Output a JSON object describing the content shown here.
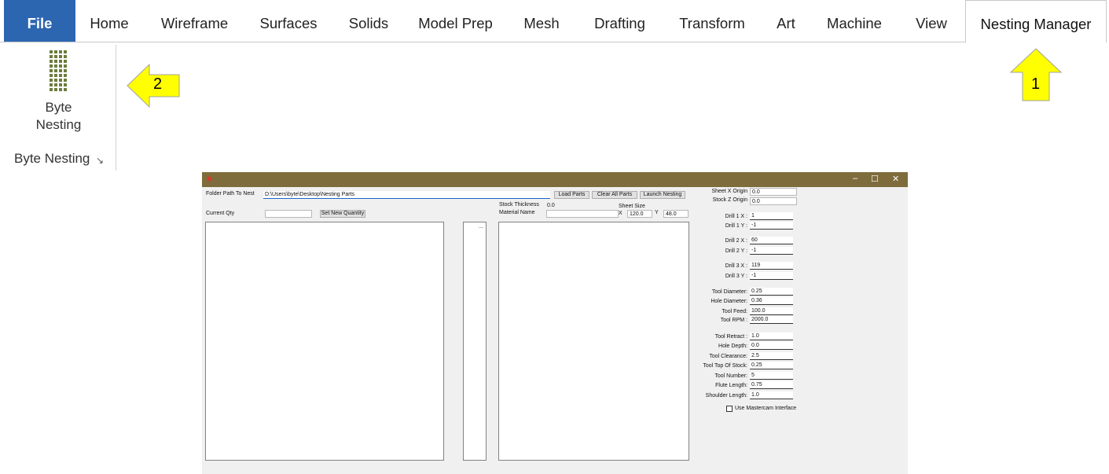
{
  "ribbon": {
    "tabs": [
      "File",
      "Home",
      "Wireframe",
      "Surfaces",
      "Solids",
      "Model Prep",
      "Mesh",
      "Drafting",
      "Transform",
      "Art",
      "Machine",
      "View",
      "Nesting Manager"
    ],
    "active_tab": "Nesting Manager",
    "file_color": "#2c66b1",
    "button": {
      "line1": "Byte",
      "line2": "Nesting",
      "icon": "grid-dots-icon"
    },
    "group_label": "Byte Nesting",
    "callouts": [
      "1",
      "2"
    ],
    "callout_color": "#ffff00"
  },
  "app": {
    "titlebar_color": "#7e6c3c",
    "controls": [
      "–",
      "☐",
      "✕"
    ],
    "folder_label": "Folder Path To Nest",
    "folder_value": "D:\\Users\\byte\\Desktop\\Nesting Parts",
    "load_parts": "Load Parts",
    "clear_all": "Clear All Parts",
    "launch": "Launch Nesting",
    "current_qty_label": "Current Qty",
    "current_qty_value": "",
    "set_qty": "Set New Quantity",
    "stock_thickness_label": "Stock Thickness",
    "stock_thickness_value": "0.0",
    "material_name_label": "Material Name",
    "material_name_value": "",
    "sheet_size_label": "Sheet Size",
    "sheet_x_label": "X",
    "sheet_x_value": "120.0",
    "sheet_y_label": "Y",
    "sheet_y_value": "48.0",
    "ellipsis": "...",
    "settings": [
      {
        "label": "Sheet X Origin",
        "value": "0.0"
      },
      {
        "label": "Stock Z Origin",
        "value": "0.0"
      },
      {
        "label": "Drill 1 X :",
        "value": "1"
      },
      {
        "label": "Drill 1 Y :",
        "value": "-1"
      },
      {
        "label": "Drill 2 X :",
        "value": "60"
      },
      {
        "label": "Drill 2 Y :",
        "value": "-1"
      },
      {
        "label": "Drill 3 X :",
        "value": "119"
      },
      {
        "label": "Drill 3 Y :",
        "value": "-1"
      },
      {
        "label": "Tool Diameter:",
        "value": "0.25"
      },
      {
        "label": "Hole Diameter:",
        "value": "0.36"
      },
      {
        "label": "Tool Feed:",
        "value": "100.0"
      },
      {
        "label": "Tool RPM :",
        "value": "2000.0"
      },
      {
        "label": "Tool Retract :",
        "value": "1.0"
      },
      {
        "label": "Hole Depth:",
        "value": "0.0"
      },
      {
        "label": "Tool Clearance:",
        "value": "2.5"
      },
      {
        "label": "Tool Top Of Stock:",
        "value": "0.25"
      },
      {
        "label": "Tool Number:",
        "value": "5"
      },
      {
        "label": "Flute Length:",
        "value": "0.75"
      },
      {
        "label": "Shoulder Length:",
        "value": "1.0"
      }
    ],
    "mastercam_label": "Use Mastercam Interface",
    "mastercam_checked": false
  }
}
